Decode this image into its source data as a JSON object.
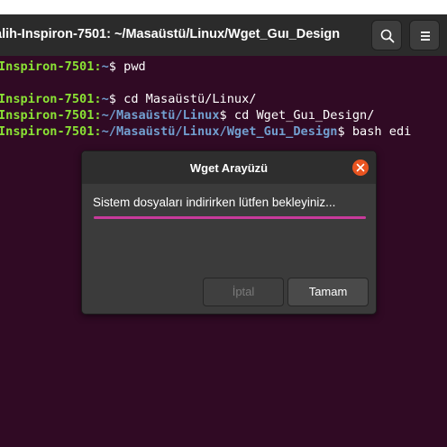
{
  "window": {
    "title": "alih-Inspiron-7501: ~/Masaüstü/Linux/Wget_Guı_Design"
  },
  "header_buttons": [
    {
      "icon": "search-icon"
    },
    {
      "icon": "hamburger-menu-icon"
    }
  ],
  "terminal": {
    "lines": [
      {
        "host": "Inspiron-7501:",
        "path": "~",
        "cmd": "$ pwd"
      },
      {
        "host": "Inspiron-7501:",
        "path": "~",
        "cmd": "$ cd Masaüstü/Linux/"
      },
      {
        "host": "Inspiron-7501:",
        "path": "~/Masaüstü/Linux",
        "cmd": "$ cd Wget_Guı_Design/"
      },
      {
        "host": "Inspiron-7501:",
        "path": "~/Masaüstü/Linux/Wget_Guı_Design",
        "cmd": "$ bash edi"
      }
    ]
  },
  "dialog": {
    "title": "Wget Arayüzü",
    "message": "Sistem dosyaları indirirken lütfen bekleyiniz...",
    "progress": 1.0,
    "cancel_label": "İptal",
    "ok_label": "Tamam"
  },
  "colors": {
    "terminal_bg": "#300a24",
    "prompt_host": "#8ae234",
    "prompt_path": "#729fcf",
    "close_button": "#e95420",
    "progress_fill": "#c83a9b"
  }
}
